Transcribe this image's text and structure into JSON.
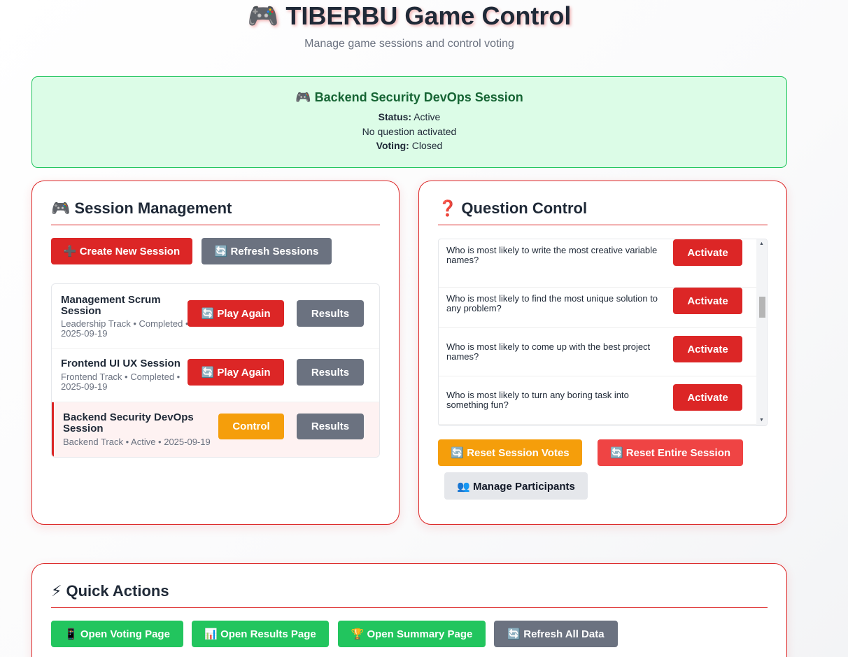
{
  "header": {
    "title": "🎮 TIBERBU Game Control",
    "subtitle": "Manage game sessions and control voting"
  },
  "status": {
    "title": "🎮 Backend Security DevOps Session",
    "status_label": "Status:",
    "status_value": "Active",
    "question_text": "No question activated",
    "voting_label": "Voting:",
    "voting_value": "Closed"
  },
  "session_mgmt": {
    "icon": "🎮",
    "title": "Session Management",
    "create_label": "➕ Create New Session",
    "refresh_label": "🔄 Refresh Sessions",
    "sessions": [
      {
        "name": "Management Scrum Session",
        "meta": "Leadership Track • Completed • 2025-09-19",
        "primary": "🔄 Play Again",
        "results": "Results"
      },
      {
        "name": "Frontend UI UX Session",
        "meta": "Frontend Track • Completed • 2025-09-19",
        "primary": "🔄 Play Again",
        "results": "Results"
      },
      {
        "name": "Backend Security DevOps Session",
        "meta": "Backend Track • Active • 2025-09-19",
        "primary": "Control",
        "results": "Results"
      }
    ]
  },
  "question_control": {
    "icon": "❓",
    "title": "Question Control",
    "questions": [
      {
        "text": "Who is most likely to write the most creative variable names?",
        "button": "Activate"
      },
      {
        "text": "Who is most likely to find the most unique solution to any problem?",
        "button": "Activate"
      },
      {
        "text": "Who is most likely to come up with the best project names?",
        "button": "Activate"
      },
      {
        "text": "Who is most likely to turn any boring task into something fun?",
        "button": "Activate"
      }
    ],
    "reset_votes_label": "🔄 Reset Session Votes",
    "reset_session_label": "🔄 Reset Entire Session",
    "manage_participants_label": "👥 Manage Participants"
  },
  "quick_actions": {
    "icon": "⚡",
    "title": "Quick Actions",
    "voting_label": "📱 Open Voting Page",
    "results_label": "📊 Open Results Page",
    "summary_label": "🏆 Open Summary Page",
    "refresh_label": "🔄 Refresh All Data"
  },
  "colors": {
    "accent_red": "#dc2626",
    "status_green_bg": "#dcfce7",
    "status_green_border": "#22c55e",
    "orange": "#f59e0b",
    "gray": "#6b7280",
    "green": "#22c55e"
  }
}
